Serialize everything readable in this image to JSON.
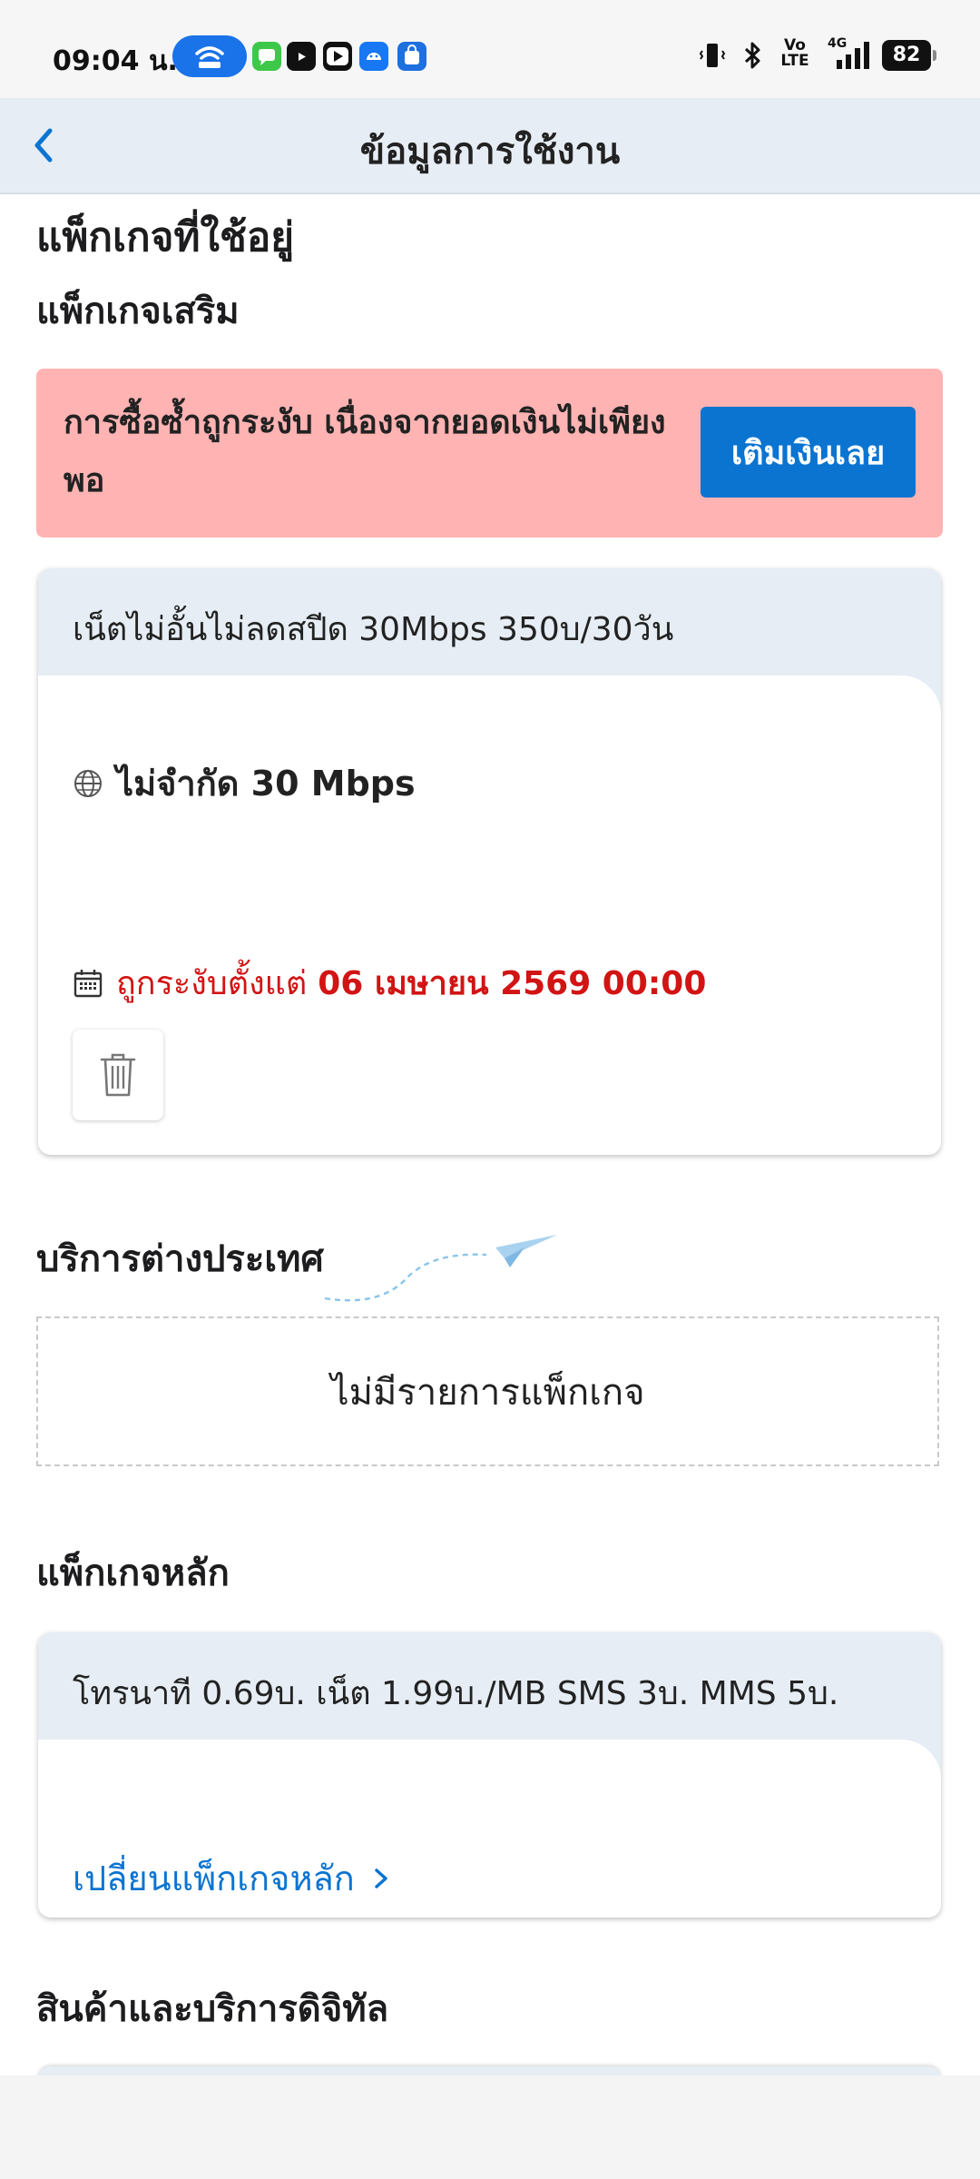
{
  "status_bar": {
    "time": "09:04 น.",
    "battery": "82",
    "network": "4G",
    "volte": "Vo LTE"
  },
  "header": {
    "title": "ข้อมูลการใช้งาน"
  },
  "current_packages": {
    "title": "แพ็กเกจที่ใช้อยู่",
    "addon_title": "แพ็กเกจเสริม",
    "alert": {
      "text": "การซื้อซ้ำถูกระงับ เนื่องจากยอดเงินไม่เพียงพอ",
      "button_label": "เติมเงินเลย",
      "color": "#ffb3b3"
    },
    "addon_card": {
      "name": "เน็ตไม่อั้นไม่ลดสปีด 30Mbps 350บ/30วัน",
      "speed": "ไม่จำกัด 30 Mbps",
      "suspended_label": "ถูกระงับตั้งแต่",
      "suspended_date": "06 เมษายน 2569 00:00"
    }
  },
  "international": {
    "title": "บริการต่างประเทศ",
    "empty_text": "ไม่มีรายการแพ็กเกจ"
  },
  "main_package": {
    "title": "แพ็กเกจหลัก",
    "name": "โทรนาที 0.69บ. เน็ต 1.99บ./MB SMS 3บ. MMS 5บ.",
    "change_link": "เปลี่ยนแพ็กเกจหลัก"
  },
  "digital": {
    "title": "สินค้าและบริการดิจิทัล"
  },
  "colors": {
    "accent": "#0b74d1",
    "error": "#d21414",
    "card_header": "#e6edf4"
  }
}
